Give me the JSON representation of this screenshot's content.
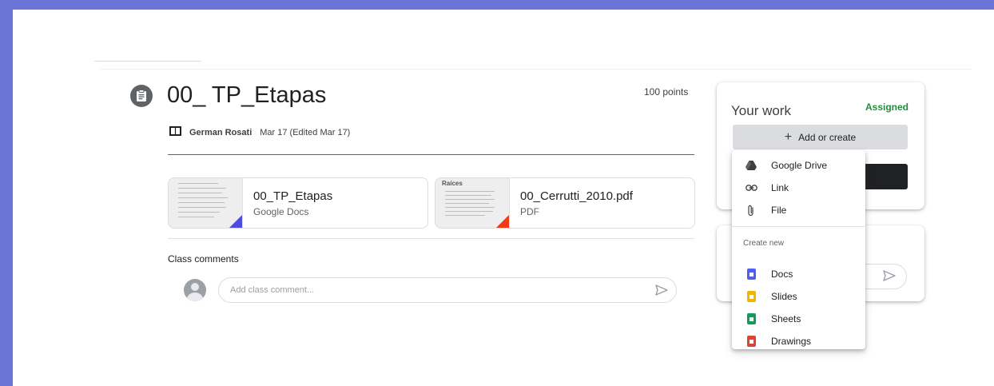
{
  "assignment": {
    "title": "00_ TP_Etapas",
    "points": "100 points",
    "author": "German Rosati",
    "date": "Mar 17 (Edited Mar 17)"
  },
  "attachments": [
    {
      "name": "00_TP_Etapas",
      "type": "Google Docs",
      "thumb_heading": ""
    },
    {
      "name": "00_Cerrutti_2010.pdf",
      "type": "PDF",
      "thumb_heading": "Raíces"
    }
  ],
  "comments": {
    "label": "Class comments",
    "placeholder": "Add class comment..."
  },
  "your_work": {
    "title": "Your work",
    "status": "Assigned",
    "add_label": "Add or create"
  },
  "menu": {
    "items": [
      {
        "label": "Google Drive",
        "icon": "google-drive-icon"
      },
      {
        "label": "Link",
        "icon": "link-icon"
      },
      {
        "label": "File",
        "icon": "paperclip-icon"
      }
    ],
    "section_label": "Create new",
    "create_items": [
      {
        "label": "Docs",
        "icon": "docs-icon",
        "color": "#4285f4"
      },
      {
        "label": "Slides",
        "icon": "slides-icon",
        "color": "#f4b400"
      },
      {
        "label": "Sheets",
        "icon": "sheets-icon",
        "color": "#0f9d58"
      },
      {
        "label": "Drawings",
        "icon": "drawings-icon",
        "color": "#db4437"
      }
    ]
  },
  "colors": {
    "frame": "#6b75d8",
    "assigned": "#1e8e3e",
    "docs_corner": "#4a4de0",
    "pdf_corner": "#f03a17"
  }
}
